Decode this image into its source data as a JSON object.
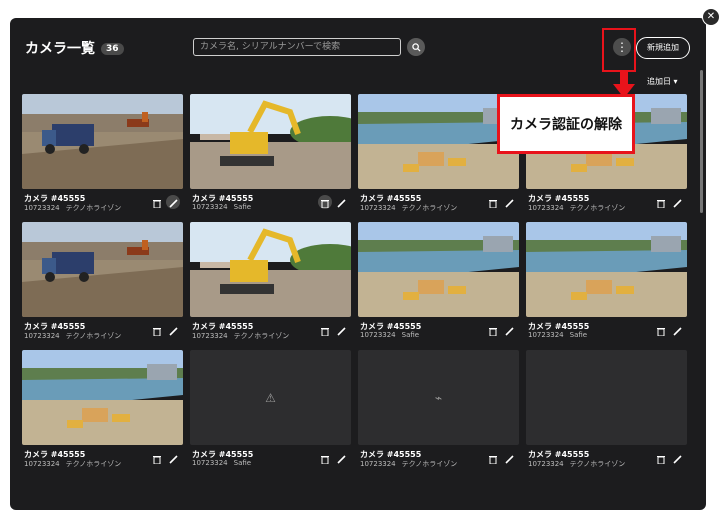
{
  "header": {
    "title": "カメラ一覧",
    "count": "36",
    "search_placeholder": "カメラ名, シリアルナンバーで検索",
    "add_label": "新規追加",
    "more_label": "⋮",
    "sort_label": "追加日 ▾"
  },
  "callout": {
    "text": "カメラ認証の解除"
  },
  "cameras": [
    {
      "name": "カメラ #45555",
      "serial": "10723324",
      "vendor": "テクノホライゾン",
      "thumb": "truck"
    },
    {
      "name": "カメラ #45555",
      "serial": "10723324",
      "vendor": "Safie",
      "thumb": "excavator"
    },
    {
      "name": "カメラ #45555",
      "serial": "10723324",
      "vendor": "テクノホライゾン",
      "thumb": "river"
    },
    {
      "name": "カメラ #45555",
      "serial": "10723324",
      "vendor": "テクノホライゾン",
      "thumb": "river"
    },
    {
      "name": "カメラ #45555",
      "serial": "10723324",
      "vendor": "テクノホライゾン",
      "thumb": "truck"
    },
    {
      "name": "カメラ #45555",
      "serial": "10723324",
      "vendor": "テクノホライゾン",
      "thumb": "excavator"
    },
    {
      "name": "カメラ #45555",
      "serial": "10723324",
      "vendor": "Safie",
      "thumb": "river"
    },
    {
      "name": "カメラ #45555",
      "serial": "10723324",
      "vendor": "Safie",
      "thumb": "river"
    },
    {
      "name": "カメラ #45555",
      "serial": "10723324",
      "vendor": "テクノホライゾン",
      "thumb": "river"
    },
    {
      "name": "カメラ #45555",
      "serial": "10723324",
      "vendor": "Safie",
      "thumb": "warning"
    },
    {
      "name": "カメラ #45555",
      "serial": "10723324",
      "vendor": "テクノホライゾン",
      "thumb": "offline"
    },
    {
      "name": "カメラ #45555",
      "serial": "10723324",
      "vendor": "テクノホライゾン",
      "thumb": "empty"
    }
  ],
  "colors": {
    "highlight": "#e8131b",
    "panel": "#1c1c1e"
  }
}
